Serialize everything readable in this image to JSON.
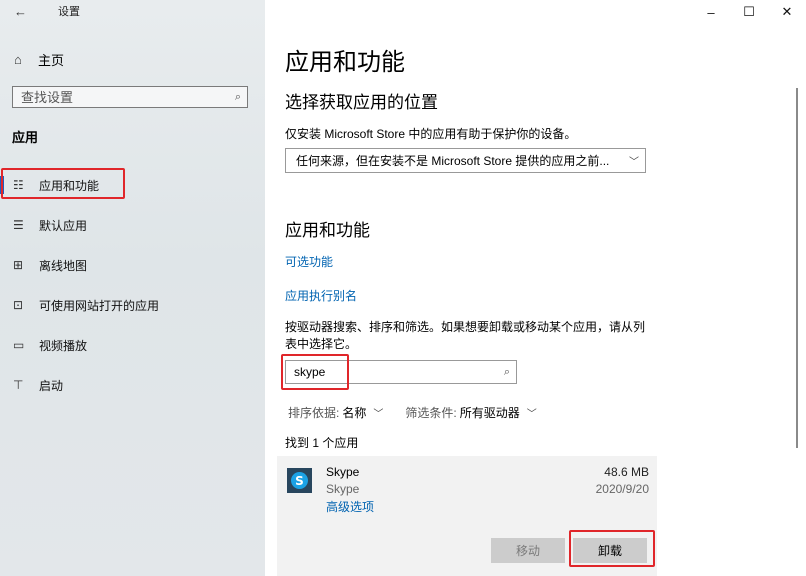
{
  "window": {
    "title": "设置",
    "back_icon": "←",
    "controls": {
      "minimize": "–",
      "maximize": "☐",
      "close": "✕"
    }
  },
  "sidebar": {
    "home": {
      "icon": "⌂",
      "label": "主页"
    },
    "search": {
      "placeholder": "查找设置",
      "icon": "⌕"
    },
    "section": "应用",
    "items": [
      {
        "icon": "☷",
        "label": "应用和功能",
        "active": true
      },
      {
        "icon": "☰",
        "label": "默认应用",
        "active": false
      },
      {
        "icon": "⊞",
        "label": "离线地图",
        "active": false
      },
      {
        "icon": "⊡",
        "label": "可使用网站打开的应用",
        "active": false
      },
      {
        "icon": "▭",
        "label": "视频播放",
        "active": false
      },
      {
        "icon": "⊤",
        "label": "启动",
        "active": false
      }
    ]
  },
  "main": {
    "title": "应用和功能",
    "location_section": {
      "heading": "选择获取应用的位置",
      "description": "仅安装 Microsoft Store 中的应用有助于保护你的设备。",
      "dropdown_value": "任何来源，但在安装不是 Microsoft Store 提供的应用之前...",
      "dropdown_icon": "﹀"
    },
    "apps_section": {
      "heading": "应用和功能",
      "link_optional": "可选功能",
      "link_alias": "应用执行别名",
      "description": "按驱动器搜索、排序和筛选。如果想要卸载或移动某个应用，请从列表中选择它。",
      "search_value": "skype",
      "search_icon": "⌕",
      "sort_label": "排序依据:",
      "sort_value": "名称",
      "filter_label": "筛选条件:",
      "filter_value": "所有驱动器",
      "chev": "﹀",
      "found_text": "找到 1 个应用"
    },
    "app_card": {
      "logo_letter": "S",
      "name": "Skype",
      "publisher": "Skype",
      "advanced_link": "高级选项",
      "size": "48.6 MB",
      "date": "2020/9/20",
      "move_button": "移动",
      "uninstall_button": "卸载"
    }
  },
  "colors": {
    "accent": "#0063b1",
    "highlight": "#e0262a",
    "nav_active_bar": "#1f5fbf"
  }
}
